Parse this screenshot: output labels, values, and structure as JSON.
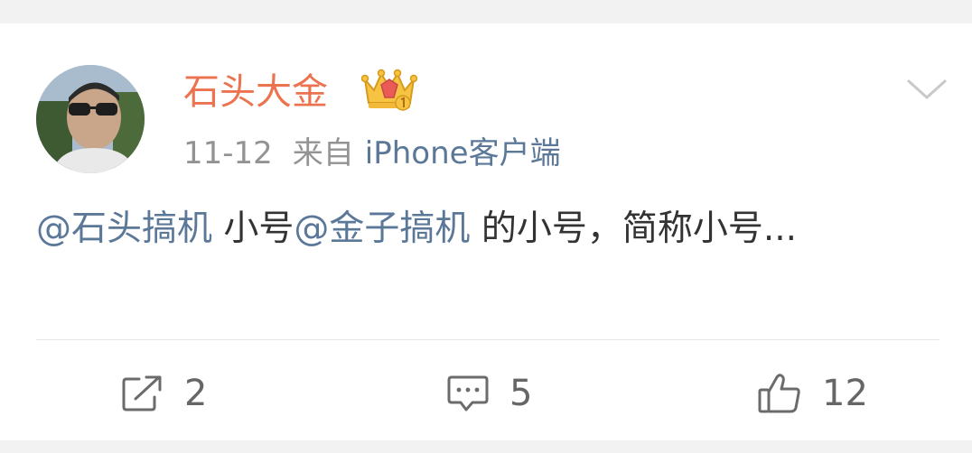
{
  "post": {
    "author": {
      "name": "石头大金",
      "avatar_icon": "user-avatar-photo",
      "badge_icon": "vip-crown-icon",
      "name_color": "#eb7350"
    },
    "time": "11-12",
    "source_prefix": "来自",
    "source_client": "iPhone客户端",
    "menu_icon": "chevron-down-icon",
    "content": {
      "mention1": "@石头搞机",
      "text1": " 小号",
      "mention2": "@金子搞机",
      "text2": " 的小号，简称小号..."
    },
    "link_color": "#5b7899"
  },
  "actions": {
    "repost": {
      "icon": "share-icon",
      "count": "2"
    },
    "comment": {
      "icon": "comment-icon",
      "count": "5"
    },
    "like": {
      "icon": "thumbs-up-icon",
      "count": "12"
    }
  }
}
